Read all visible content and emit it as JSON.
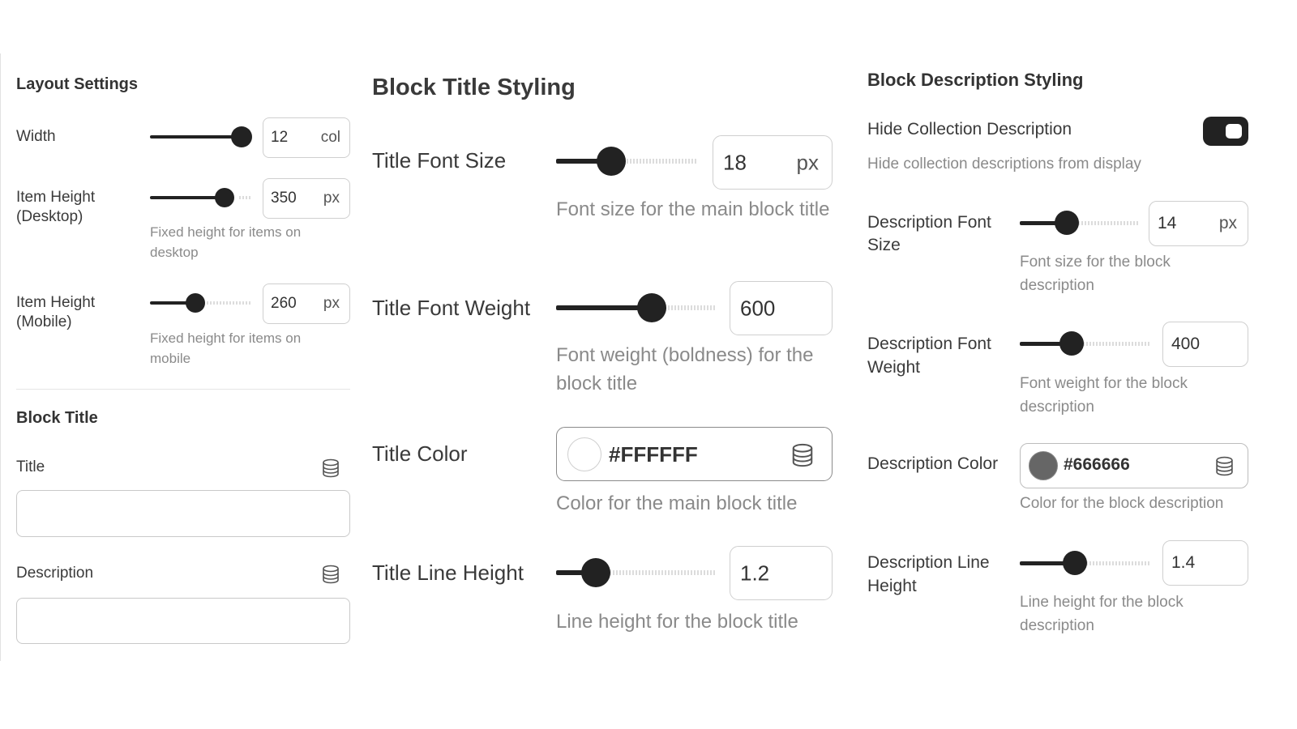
{
  "layout": {
    "heading": "Layout Settings",
    "width": {
      "label": "Width",
      "value": "12",
      "unit": "col",
      "level": 1.0
    },
    "item_height_desktop": {
      "label": "Item Height (Desktop)",
      "value": "350",
      "unit": "px",
      "level": 0.8,
      "help": "Fixed height for items on desktop"
    },
    "item_height_mobile": {
      "label": "Item Height (Mobile)",
      "value": "260",
      "unit": "px",
      "level": 0.45,
      "help": "Fixed height for items on mobile"
    }
  },
  "block_title": {
    "heading": "Block Title",
    "title_label": "Title",
    "title_value": "",
    "description_label": "Description",
    "description_value": ""
  },
  "title_styling": {
    "heading": "Block Title Styling",
    "font_size": {
      "label": "Title Font Size",
      "value": "18",
      "unit": "px",
      "level": 0.38,
      "help": "Font size for the main block title"
    },
    "font_weight": {
      "label": "Title Font Weight",
      "value": "600",
      "level": 0.6,
      "help": "Font weight (boldness) for the block title"
    },
    "color": {
      "label": "Title Color",
      "value": "#FFFFFF",
      "swatch": "#ffffff",
      "help": "Color for the main block title"
    },
    "line_height": {
      "label": "Title Line Height",
      "value": "1.2",
      "level": 0.25,
      "help": "Line height for the block title"
    }
  },
  "description_styling": {
    "heading": "Block Description Styling",
    "hide": {
      "label": "Hide Collection Description",
      "help": "Hide collection descriptions from display",
      "on": true
    },
    "font_size": {
      "label": "Description Font Size",
      "value": "14",
      "unit": "px",
      "level": 0.4,
      "help": "Font size for the block description"
    },
    "font_weight": {
      "label": "Description Font Weight",
      "value": "400",
      "level": 0.4,
      "help": "Font weight for the block description"
    },
    "color": {
      "label": "Description Color",
      "value": "#666666",
      "swatch": "#666666",
      "help": "Color for the block description"
    },
    "line_height": {
      "label": "Description Line Height",
      "value": "1.4",
      "level": 0.42,
      "help": "Line height for the block description"
    }
  }
}
